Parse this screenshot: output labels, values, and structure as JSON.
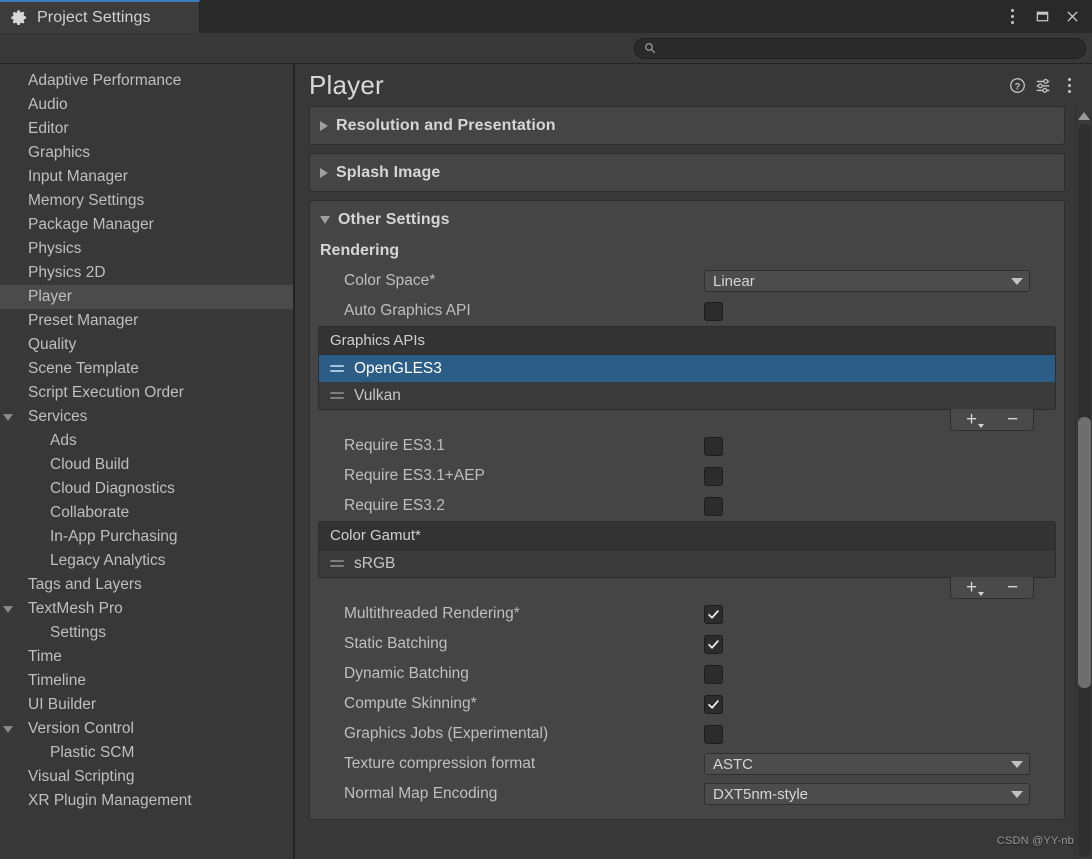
{
  "window": {
    "tab_label": "Project Settings",
    "tab_icon": "gear-icon",
    "accent_color": "#3d7bbd",
    "controls": {
      "menu_label": "⋮",
      "maximize_label": "□",
      "close_label": "✕"
    }
  },
  "search": {
    "value": "",
    "placeholder": "",
    "icon": "search-icon"
  },
  "sidebar": {
    "items": [
      {
        "label": "Adaptive Performance",
        "depth": 0,
        "arrow": "none",
        "selected": false
      },
      {
        "label": "Audio",
        "depth": 0,
        "arrow": "none",
        "selected": false
      },
      {
        "label": "Editor",
        "depth": 0,
        "arrow": "none",
        "selected": false
      },
      {
        "label": "Graphics",
        "depth": 0,
        "arrow": "none",
        "selected": false
      },
      {
        "label": "Input Manager",
        "depth": 0,
        "arrow": "none",
        "selected": false
      },
      {
        "label": "Memory Settings",
        "depth": 0,
        "arrow": "none",
        "selected": false
      },
      {
        "label": "Package Manager",
        "depth": 0,
        "arrow": "none",
        "selected": false
      },
      {
        "label": "Physics",
        "depth": 0,
        "arrow": "none",
        "selected": false
      },
      {
        "label": "Physics 2D",
        "depth": 0,
        "arrow": "none",
        "selected": false
      },
      {
        "label": "Player",
        "depth": 0,
        "arrow": "none",
        "selected": true
      },
      {
        "label": "Preset Manager",
        "depth": 0,
        "arrow": "none",
        "selected": false
      },
      {
        "label": "Quality",
        "depth": 0,
        "arrow": "none",
        "selected": false
      },
      {
        "label": "Scene Template",
        "depth": 0,
        "arrow": "none",
        "selected": false
      },
      {
        "label": "Script Execution Order",
        "depth": 0,
        "arrow": "none",
        "selected": false
      },
      {
        "label": "Services",
        "depth": 0,
        "arrow": "down",
        "selected": false
      },
      {
        "label": "Ads",
        "depth": 1,
        "arrow": "none",
        "selected": false
      },
      {
        "label": "Cloud Build",
        "depth": 1,
        "arrow": "none",
        "selected": false
      },
      {
        "label": "Cloud Diagnostics",
        "depth": 1,
        "arrow": "none",
        "selected": false
      },
      {
        "label": "Collaborate",
        "depth": 1,
        "arrow": "none",
        "selected": false
      },
      {
        "label": "In-App Purchasing",
        "depth": 1,
        "arrow": "none",
        "selected": false
      },
      {
        "label": "Legacy Analytics",
        "depth": 1,
        "arrow": "none",
        "selected": false
      },
      {
        "label": "Tags and Layers",
        "depth": 0,
        "arrow": "none",
        "selected": false
      },
      {
        "label": "TextMesh Pro",
        "depth": 0,
        "arrow": "down",
        "selected": false
      },
      {
        "label": "Settings",
        "depth": 1,
        "arrow": "none",
        "selected": false
      },
      {
        "label": "Time",
        "depth": 0,
        "arrow": "none",
        "selected": false
      },
      {
        "label": "Timeline",
        "depth": 0,
        "arrow": "none",
        "selected": false
      },
      {
        "label": "UI Builder",
        "depth": 0,
        "arrow": "none",
        "selected": false
      },
      {
        "label": "Version Control",
        "depth": 0,
        "arrow": "down",
        "selected": false
      },
      {
        "label": "Plastic SCM",
        "depth": 1,
        "arrow": "none",
        "selected": false
      },
      {
        "label": "Visual Scripting",
        "depth": 0,
        "arrow": "none",
        "selected": false
      },
      {
        "label": "XR Plugin Management",
        "depth": 0,
        "arrow": "none",
        "selected": false
      }
    ]
  },
  "panel": {
    "title": "Player",
    "header_icons": [
      "help-icon",
      "preset-icon",
      "kebab-menu-icon"
    ],
    "sections": [
      {
        "title": "Resolution and Presentation",
        "expanded": false
      },
      {
        "title": "Splash Image",
        "expanded": false
      },
      {
        "title": "Other Settings",
        "expanded": true
      }
    ],
    "other_settings": {
      "group_label": "Rendering",
      "color_space": {
        "label": "Color Space*",
        "value": "Linear",
        "type": "dropdown"
      },
      "auto_graphics_api": {
        "label": "Auto Graphics API",
        "checked": false,
        "type": "checkbox"
      },
      "graphics_apis": {
        "header": "Graphics APIs",
        "items": [
          {
            "label": "OpenGLES3",
            "selected": true
          },
          {
            "label": "Vulkan",
            "selected": false
          }
        ],
        "add_label": "+",
        "remove_label": "−"
      },
      "es_requirements": [
        {
          "label": "Require ES3.1",
          "checked": false
        },
        {
          "label": "Require ES3.1+AEP",
          "checked": false
        },
        {
          "label": "Require ES3.2",
          "checked": false
        }
      ],
      "color_gamut": {
        "header": "Color Gamut*",
        "items": [
          {
            "label": "sRGB",
            "selected": false
          }
        ],
        "add_label": "+",
        "remove_label": "−"
      },
      "toggles": [
        {
          "label": "Multithreaded Rendering*",
          "checked": true
        },
        {
          "label": "Static Batching",
          "checked": true
        },
        {
          "label": "Dynamic Batching",
          "checked": false
        },
        {
          "label": "Compute Skinning*",
          "checked": true
        },
        {
          "label": "Graphics Jobs (Experimental)",
          "checked": false
        }
      ],
      "texture_compression": {
        "label": "Texture compression format",
        "value": "ASTC",
        "type": "dropdown"
      },
      "normal_map_encoding": {
        "label": "Normal Map Encoding",
        "value": "DXT5nm-style",
        "type": "dropdown"
      }
    }
  },
  "scrollbar": {
    "up_arrow": "▲"
  },
  "watermark": {
    "text": "CSDN @YY-nb"
  },
  "colors": {
    "selection_blue": "#2c5d87",
    "tab_accent": "#3d7bbd",
    "panel_bg": "#383838",
    "foldout_bg": "#454545",
    "sidebar_selected": "#4b4b4b"
  }
}
